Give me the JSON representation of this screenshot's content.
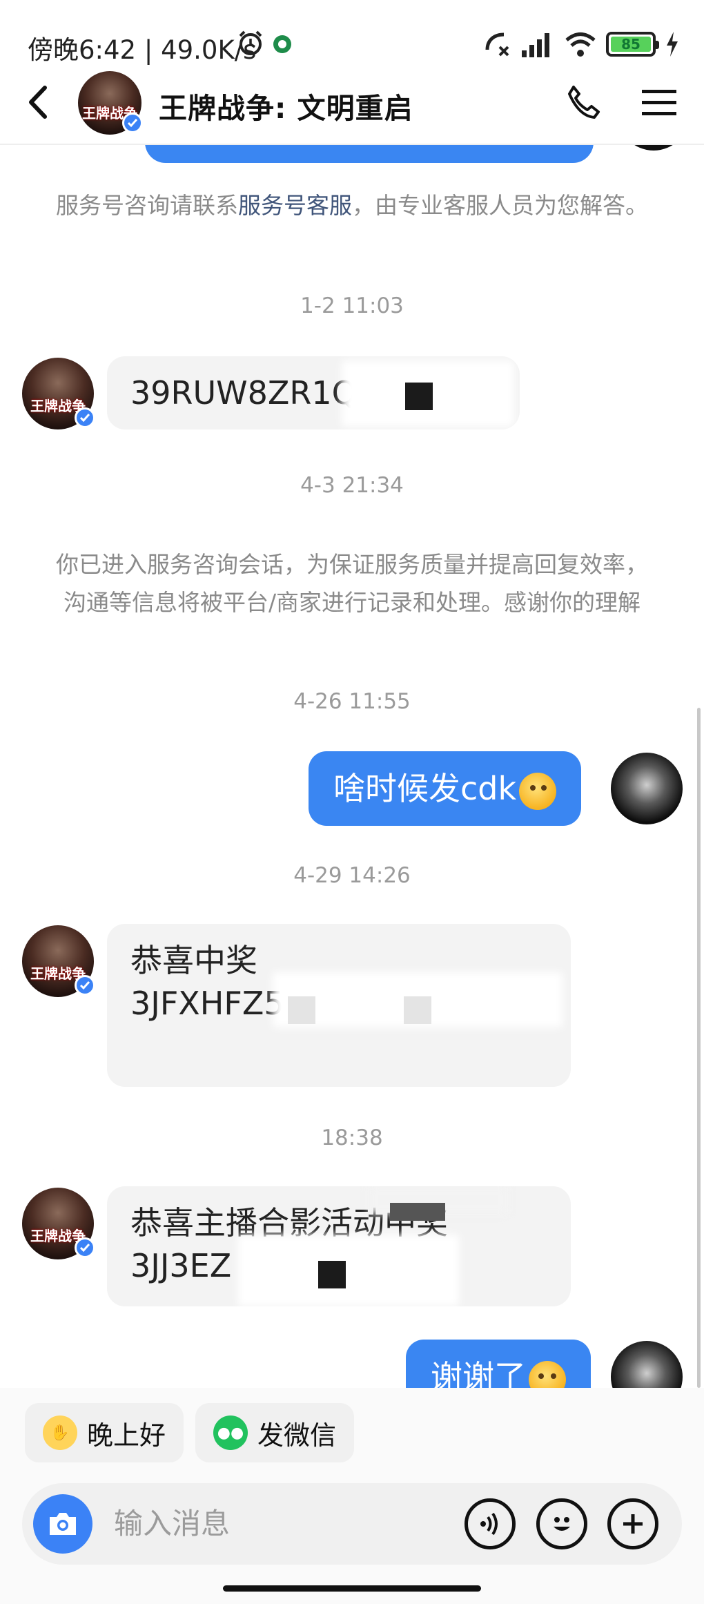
{
  "status_bar": {
    "text": "傍晚6:42 | 49.0K/s",
    "battery": "85",
    "icons": [
      "alarm-icon",
      "location-icon",
      "call-off-icon",
      "signal-icon",
      "wifi-icon",
      "battery-icon",
      "charging-icon"
    ]
  },
  "header": {
    "title": "王牌战争: 文明重启",
    "icons": [
      "back-icon",
      "phone-icon",
      "menu-icon"
    ]
  },
  "brand": {
    "logo_text": "王牌战争"
  },
  "messages": {
    "service_notice_before": "服务号咨询请联系",
    "service_notice_link": "服务号客服",
    "service_notice_after": "，由专业客服人员为您解答。",
    "ts1": "1-2 11:03",
    "msg1": "39RUW8ZR1Q3",
    "ts2": "4-3 21:34",
    "session_notice": "你已进入服务咨询会话，为保证服务质量并提高回复效率，沟通等信息将被平台/商家进行记录和处理。感谢你的理解",
    "ts3": "4-26 11:55",
    "out1": "啥时候发cdk",
    "ts4": "4-29 14:26",
    "msg2_line1": "恭喜中奖",
    "msg2_line2": "3JFXHFZ5ZM",
    "ts5": "18:38",
    "msg3_line1": "恭喜主播合影活动中奖",
    "msg3_line2": "3JJ3EZ",
    "out2": "谢谢了"
  },
  "quick_replies": [
    {
      "label": "晚上好",
      "icon": "wave-icon"
    },
    {
      "label": "发微信",
      "icon": "wechat-icon"
    }
  ],
  "input": {
    "placeholder": "输入消息",
    "buttons": [
      "camera-icon",
      "voice-icon",
      "emoji-icon",
      "plus-icon"
    ]
  },
  "colors": {
    "accent": "#3b82f6",
    "bubble_out": "#3a86f2",
    "bubble_in": "#f3f3f3",
    "link": "#40557a"
  }
}
